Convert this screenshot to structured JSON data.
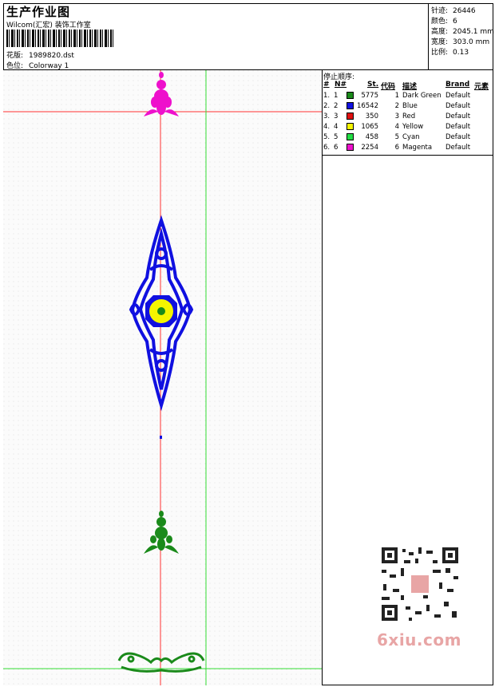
{
  "header": {
    "title": "生产作业图",
    "company": "Wilcom(汇宏) 装饰工作室",
    "design_label": "花版:",
    "design_value": "1989820.dst",
    "colorway_label": "色位:",
    "colorway_value": "Colorway 1"
  },
  "stats": [
    {
      "label": "针迹:",
      "value": "26446"
    },
    {
      "label": "颜色:",
      "value": "6"
    },
    {
      "label": "高度:",
      "value": "2045.1 mm"
    },
    {
      "label": "宽度:",
      "value": "303.0 mm"
    },
    {
      "label": "比例:",
      "value": "0.13"
    }
  ],
  "stop_sequence": {
    "caption": "停止顺序:",
    "columns": [
      "#",
      "N#",
      "St.",
      "代码",
      "描述",
      "Brand",
      "元素"
    ],
    "rows": [
      {
        "idx": "1.",
        "n": "1",
        "st": "5775",
        "code": "1",
        "desc": "Dark Green",
        "brand": "Default",
        "color": "#1a8a1a"
      },
      {
        "idx": "2.",
        "n": "2",
        "st": "16542",
        "code": "2",
        "desc": "Blue",
        "brand": "Default",
        "color": "#1010e0"
      },
      {
        "idx": "3.",
        "n": "3",
        "st": "350",
        "code": "3",
        "desc": "Red",
        "brand": "Default",
        "color": "#e01010"
      },
      {
        "idx": "4.",
        "n": "4",
        "st": "1065",
        "code": "4",
        "desc": "Yellow",
        "brand": "Default",
        "color": "#f5f500"
      },
      {
        "idx": "5.",
        "n": "5",
        "st": "458",
        "code": "5",
        "desc": "Cyan",
        "brand": "Default",
        "color": "#22dd44"
      },
      {
        "idx": "6.",
        "n": "6",
        "st": "2254",
        "code": "6",
        "desc": "Magenta",
        "brand": "Default",
        "color": "#ee10cc"
      }
    ]
  },
  "watermark": {
    "text": "6xiu.com"
  }
}
